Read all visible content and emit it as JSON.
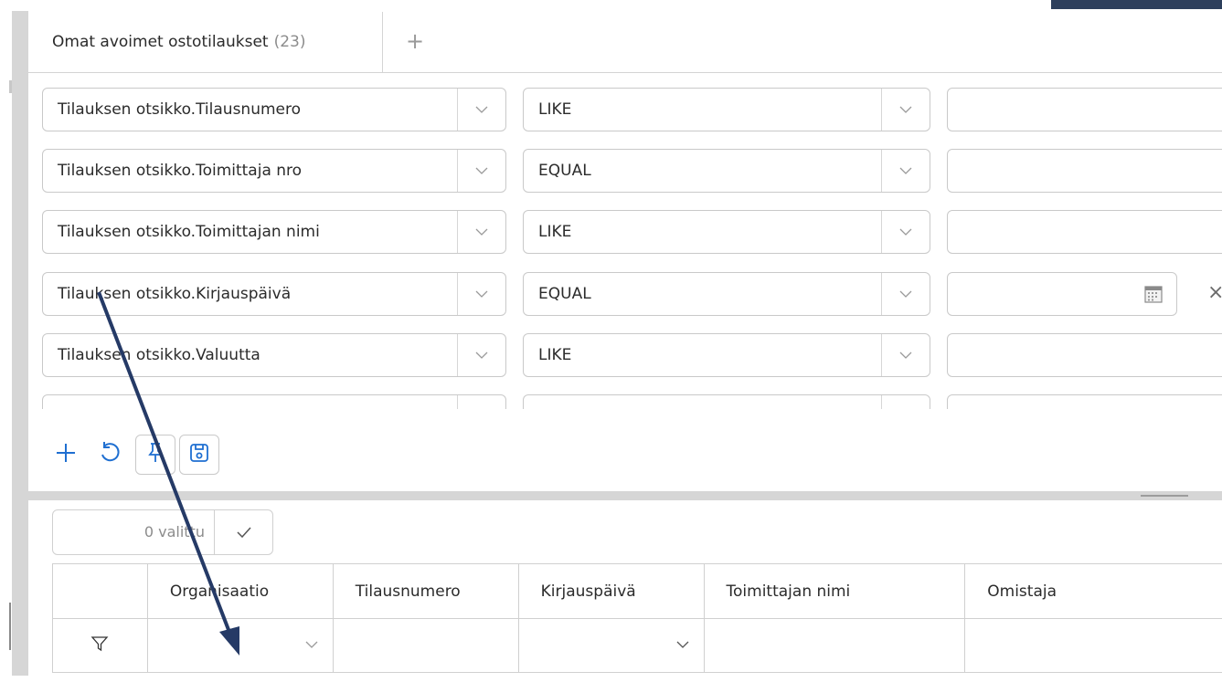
{
  "tabs": {
    "active": {
      "label": "Omat avoimet ostotilaukset",
      "count": "(23)"
    },
    "add_label": "+"
  },
  "filters": [
    {
      "field": "Tilauksen otsikko.Tilausnumero",
      "operator": "LIKE",
      "value": ""
    },
    {
      "field": "Tilauksen otsikko.Toimittaja nro",
      "operator": "EQUAL",
      "value": ""
    },
    {
      "field": "Tilauksen otsikko.Toimittajan nimi",
      "operator": "LIKE",
      "value": ""
    },
    {
      "field": "Tilauksen otsikko.Kirjauspäivä",
      "operator": "EQUAL",
      "value": "",
      "has_calendar": true,
      "clear_label": "×"
    },
    {
      "field": "Tilauksen otsikko.Valuutta",
      "operator": "LIKE",
      "value": ""
    }
  ],
  "toolbar": {
    "icons": [
      "add-icon",
      "undo-icon",
      "pin-icon",
      "save-icon"
    ]
  },
  "selection": {
    "label": "0 valittu"
  },
  "grid": {
    "columns": [
      "Organisaatio",
      "Tilausnumero",
      "Kirjauspäivä",
      "Toimittajan nimi",
      "Omistaja"
    ]
  },
  "colors": {
    "accent": "#1f6fd1",
    "annotation_arrow": "#253a66",
    "border": "#c9c9c9"
  }
}
